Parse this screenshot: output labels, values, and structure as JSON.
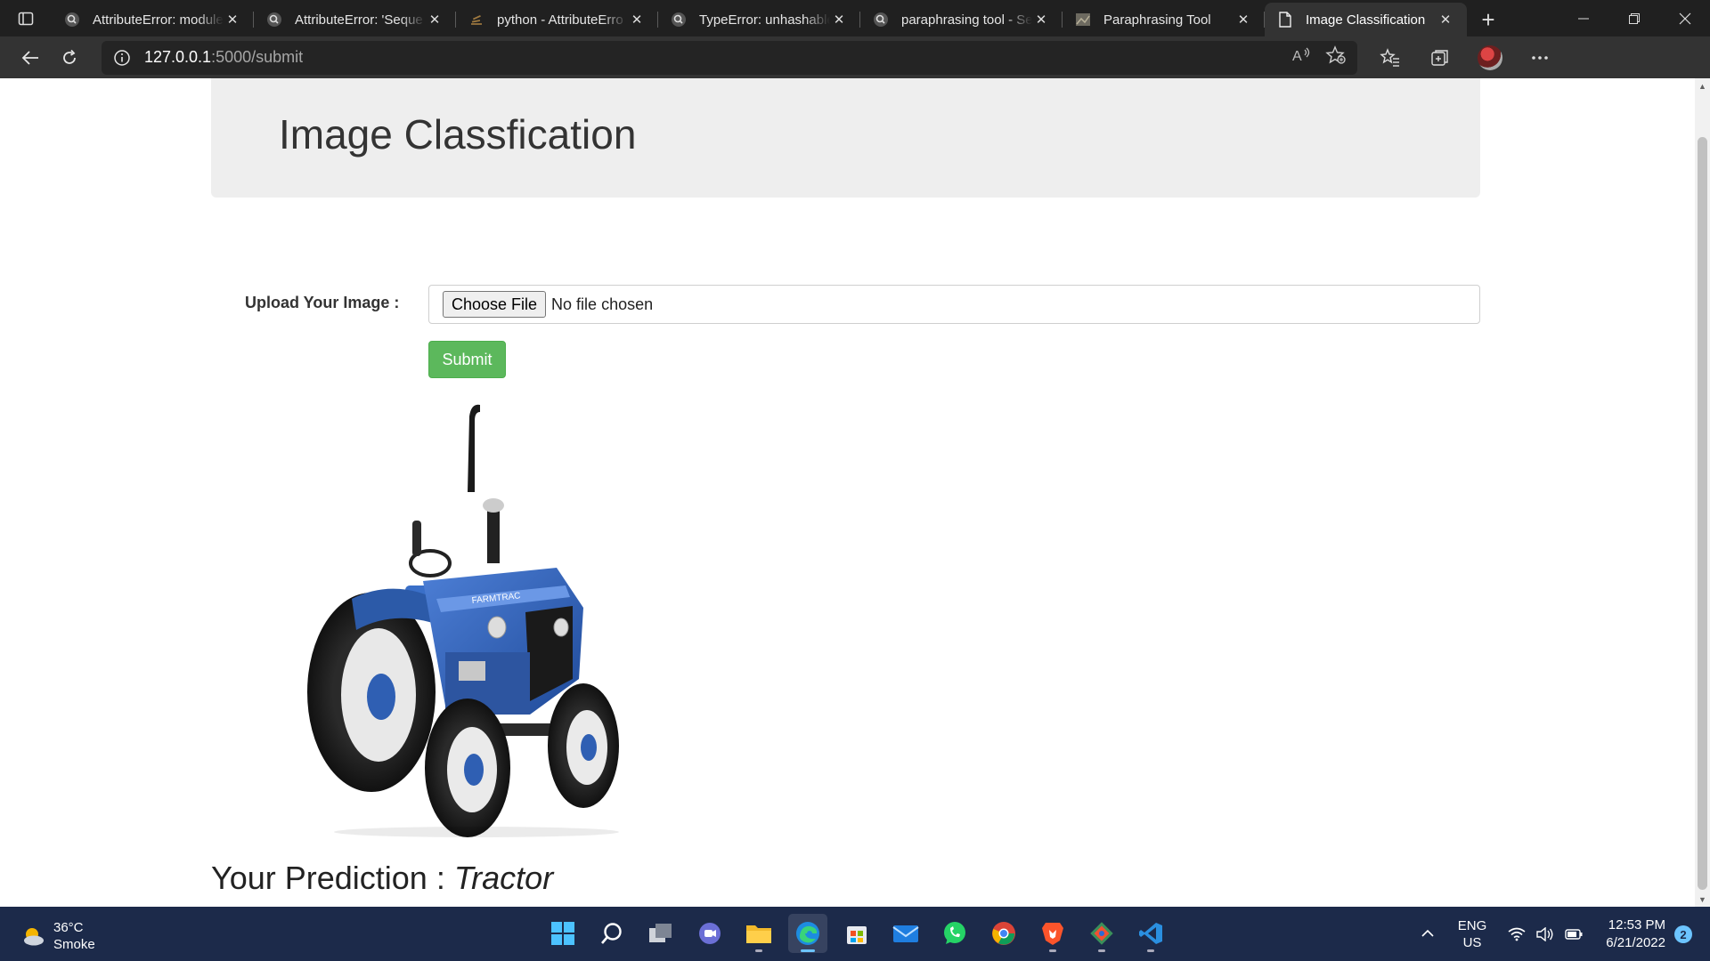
{
  "browser": {
    "tabs": [
      {
        "title": "AttributeError: module",
        "icon": "search-icon",
        "active": false
      },
      {
        "title": "AttributeError: 'Seque",
        "icon": "search-icon",
        "active": false
      },
      {
        "title": "python - AttributeErro",
        "icon": "stackoverflow-icon",
        "active": false
      },
      {
        "title": "TypeError: unhashable",
        "icon": "search-icon",
        "active": false
      },
      {
        "title": "paraphrasing tool - Se",
        "icon": "search-icon",
        "active": false
      },
      {
        "title": "Paraphrasing Tool",
        "icon": "image-favicon-icon",
        "active": false
      },
      {
        "title": "Image Classification",
        "icon": "page-icon",
        "active": true
      }
    ],
    "address": {
      "host": "127.0.0.1",
      "rest": ":5000/submit"
    }
  },
  "page": {
    "heading": "Image Classfication",
    "upload_label": "Upload Your Image :",
    "file_button": "Choose File",
    "file_status": "No file chosen",
    "submit_label": "Submit",
    "prediction_prefix": "Your Prediction :",
    "prediction_value": "Tractor",
    "image_brand_text": "FARMTRAC",
    "colors": {
      "submit": "#5cb85c",
      "jumbotron": "#eeeeee",
      "tractor_body": "#2f5fb3"
    }
  },
  "taskbar": {
    "weather": {
      "temp": "36°C",
      "desc": "Smoke"
    },
    "apps": [
      "start-icon",
      "search-icon",
      "task-view-icon",
      "teams-chat-icon",
      "file-explorer-icon",
      "edge-icon",
      "store-icon",
      "mail-icon",
      "whatsapp-icon",
      "chrome-icon",
      "brave-icon",
      "git-icon",
      "vscode-icon"
    ],
    "language": {
      "lang": "ENG",
      "region": "US"
    },
    "clock": {
      "time": "12:53 PM",
      "date": "6/21/2022"
    },
    "notifications": "2"
  }
}
